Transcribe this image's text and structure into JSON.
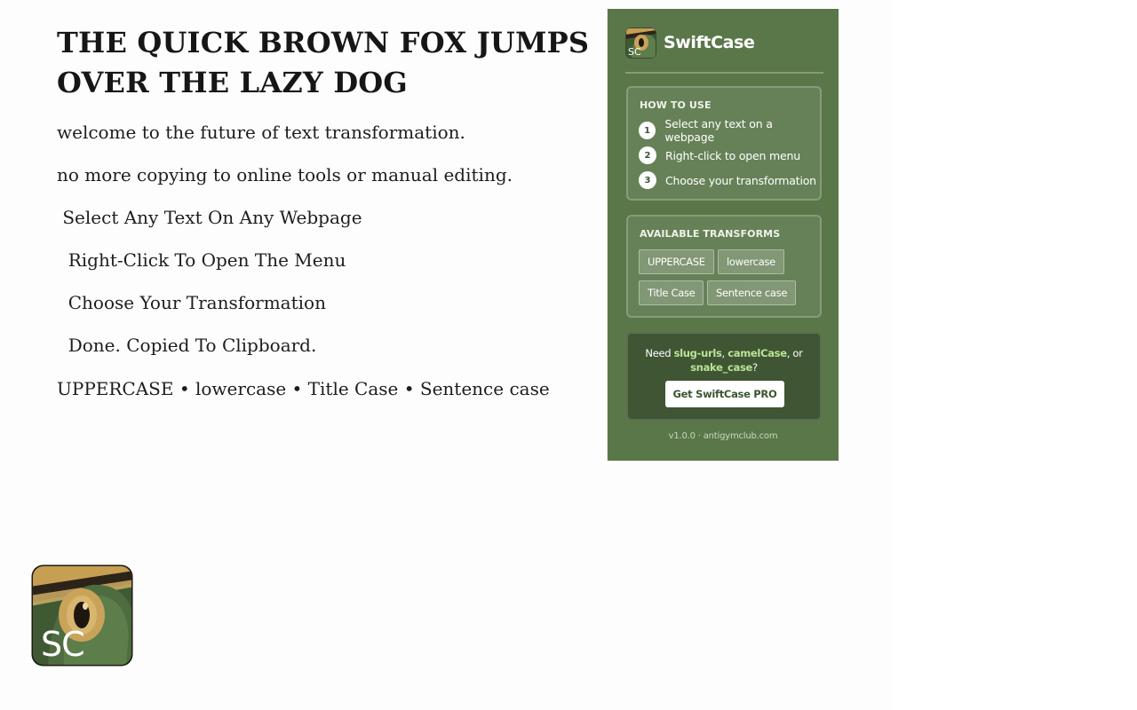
{
  "demo": {
    "headline_line1": "THE QUICK BROWN FOX JUMPS",
    "headline_line2": "OVER THE LAZY DOG",
    "lines": [
      "welcome to the future of text transformation.",
      "no more copying to online tools or manual editing.",
      " Select Any Text On Any Webpage",
      "  Right-Click To Open The Menu",
      "  Choose Your Transformation",
      "  Done. Copied To Clipboard.",
      "UPPERCASE • lowercase • Title Case • Sentence case"
    ]
  },
  "logo": {
    "text": "SC",
    "icon": "swiftcase-logo-icon"
  },
  "popup": {
    "brand": "SwiftCase",
    "how_to_use": {
      "title": "HOW TO USE",
      "steps": [
        {
          "num": "1",
          "label": "Select any text on a webpage"
        },
        {
          "num": "2",
          "label": "Right-click to open menu"
        },
        {
          "num": "3",
          "label": "Choose your transformation"
        }
      ]
    },
    "transforms": {
      "title": "AVAILABLE TRANSFORMS",
      "items": [
        "UPPERCASE",
        "lowercase",
        "Title Case",
        "Sentence case"
      ]
    },
    "pro": {
      "text_prefix": "Need ",
      "slug": "slug-urls",
      "sep1": ", ",
      "camel": "camelCase",
      "sep2": ", or",
      "snake": "snake_case",
      "suffix": "?",
      "button": "Get SwiftCase PRO"
    },
    "footer": {
      "version": "v1.0.0",
      "sep": " · ",
      "site": "antigymclub.com"
    }
  },
  "colors": {
    "panel_bg": "#597749",
    "accent_highlight": "#b9e496",
    "logo_gold": "#d2a95c",
    "logo_dark": "#2c2418"
  }
}
